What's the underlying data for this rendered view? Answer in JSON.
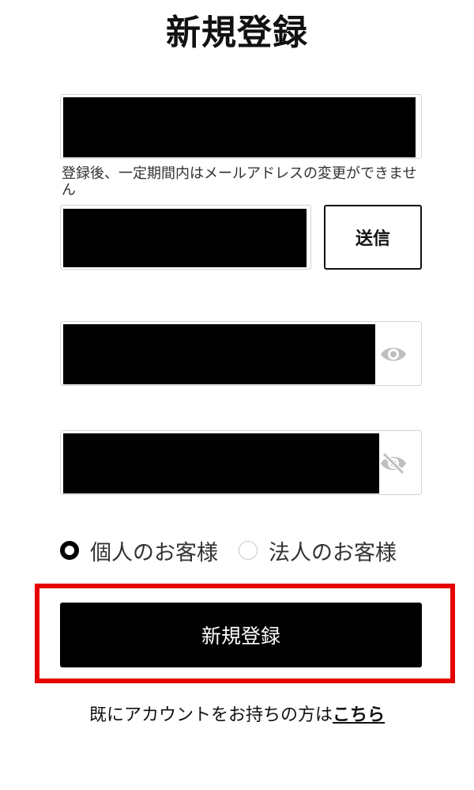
{
  "page": {
    "title": "新規登録"
  },
  "email": {
    "note": "登録後、一定期間内はメールアドレスの変更ができません"
  },
  "verification": {
    "send_label": "送信"
  },
  "password": {
    "show_icon": "eye-icon"
  },
  "password_confirm": {
    "hide_icon": "eye-slash-icon"
  },
  "customer_type": {
    "options": [
      {
        "label": "個人のお客様",
        "selected": true
      },
      {
        "label": "法人のお客様",
        "selected": false
      }
    ]
  },
  "submit": {
    "label": "新規登録"
  },
  "login": {
    "prompt": "既にアカウントをお持ちの方は",
    "link": "こちら"
  },
  "colors": {
    "highlight": "#e60000",
    "button": "#000000",
    "icon": "#bfbfbf"
  }
}
